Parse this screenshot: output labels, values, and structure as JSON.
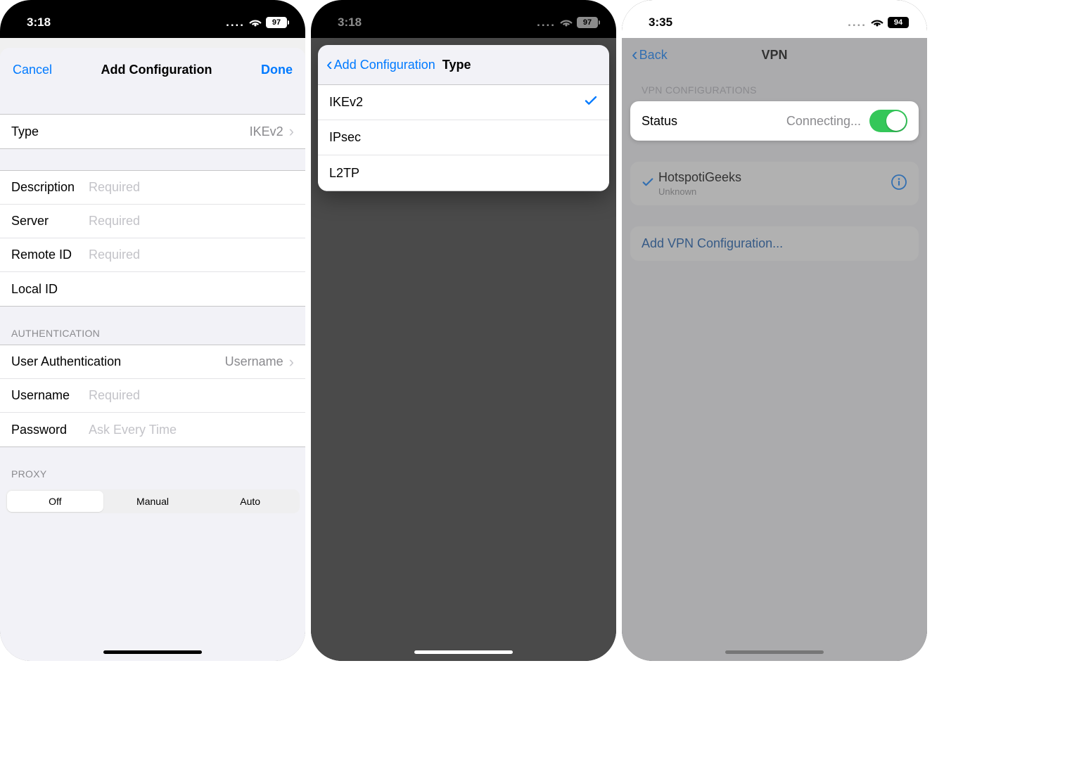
{
  "screen1": {
    "time": "3:18",
    "battery": "97",
    "nav": {
      "cancel": "Cancel",
      "title": "Add Configuration",
      "done": "Done"
    },
    "type_row": {
      "label": "Type",
      "value": "IKEv2"
    },
    "fields": {
      "description": {
        "label": "Description",
        "placeholder": "Required"
      },
      "server": {
        "label": "Server",
        "placeholder": "Required"
      },
      "remote_id": {
        "label": "Remote ID",
        "placeholder": "Required"
      },
      "local_id": {
        "label": "Local ID"
      }
    },
    "auth": {
      "header": "AUTHENTICATION",
      "user_auth": {
        "label": "User Authentication",
        "value": "Username"
      },
      "username": {
        "label": "Username",
        "placeholder": "Required"
      },
      "password": {
        "label": "Password",
        "placeholder": "Ask Every Time"
      }
    },
    "proxy": {
      "header": "PROXY",
      "options": [
        "Off",
        "Manual",
        "Auto"
      ],
      "selected": 0
    }
  },
  "screen2": {
    "time": "3:18",
    "battery": "97",
    "back": "Add Configuration",
    "title": "Type",
    "options": [
      {
        "label": "IKEv2",
        "selected": true
      },
      {
        "label": "IPsec",
        "selected": false
      },
      {
        "label": "L2TP",
        "selected": false
      }
    ]
  },
  "screen3": {
    "time": "3:35",
    "battery": "94",
    "back": "Back",
    "title": "VPN",
    "configs_header": "VPN CONFIGURATIONS",
    "status": {
      "label": "Status",
      "value": "Connecting...",
      "on": true
    },
    "entry": {
      "name": "HotspotiGeeks",
      "sub": "Unknown"
    },
    "add": "Add VPN Configuration..."
  }
}
